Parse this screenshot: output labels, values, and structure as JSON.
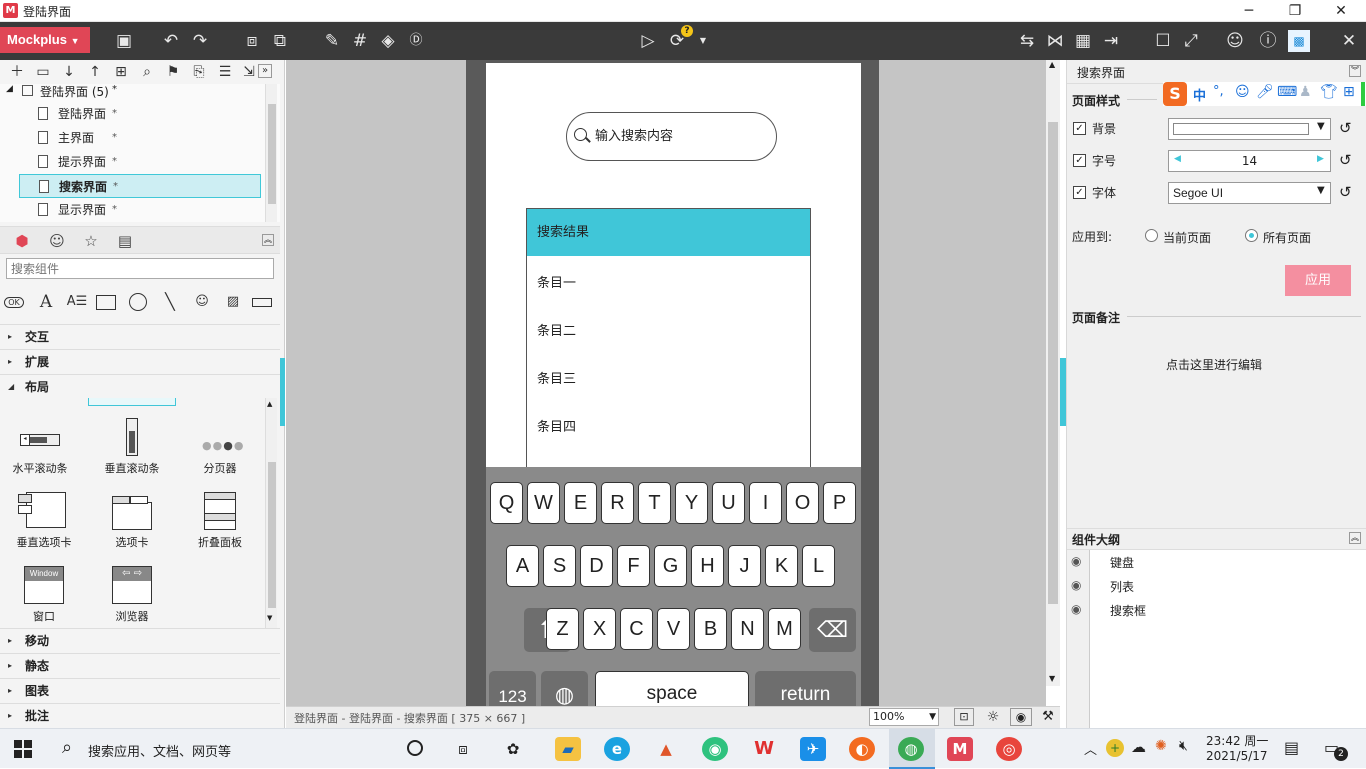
{
  "window": {
    "title": "登陆界面",
    "logo_letter": "M"
  },
  "toolbar": {
    "app_button": "Mockplus",
    "help_badge": "?"
  },
  "left_panel": {
    "tree_root": "登陆界面 (5)",
    "tree_items": [
      {
        "label": "登陆界面",
        "selected": false
      },
      {
        "label": "主界面",
        "selected": false
      },
      {
        "label": "提示界面",
        "selected": false
      },
      {
        "label": "搜索界面",
        "selected": true
      },
      {
        "label": "显示界面",
        "selected": false
      }
    ],
    "modified_mark": "*",
    "component_search_placeholder": "搜索组件",
    "categories_top": [
      "交互",
      "扩展"
    ],
    "open_category": "布局",
    "widgets": [
      {
        "label": "水平滚动条",
        "icon": "horizontal-scrollbar-icon"
      },
      {
        "label": "垂直滚动条",
        "icon": "vertical-scrollbar-icon"
      },
      {
        "label": "分页器",
        "icon": "pager-icon"
      },
      {
        "label": "垂直选项卡",
        "icon": "vertical-tabs-icon"
      },
      {
        "label": "选项卡",
        "icon": "tabs-icon"
      },
      {
        "label": "折叠面板",
        "icon": "accordion-icon"
      },
      {
        "label": "窗口",
        "icon": "window-icon",
        "caption": "Window"
      },
      {
        "label": "浏览器",
        "icon": "browser-icon"
      }
    ],
    "categories_bottom": [
      "移动",
      "静态",
      "图表",
      "批注"
    ]
  },
  "screen": {
    "search_placeholder": "输入搜索内容",
    "list_header": "搜索结果",
    "list_items": [
      "条目一",
      "条目二",
      "条目三",
      "条目四"
    ],
    "keyboard": {
      "row1": [
        "Q",
        "W",
        "E",
        "R",
        "T",
        "Y",
        "U",
        "I",
        "O",
        "P"
      ],
      "row2": [
        "A",
        "S",
        "D",
        "F",
        "G",
        "H",
        "J",
        "K",
        "L"
      ],
      "row3": [
        "Z",
        "X",
        "C",
        "V",
        "B",
        "N",
        "M"
      ],
      "num_key": "123",
      "space_key": "space",
      "return_key": "return"
    }
  },
  "statusbar": {
    "path": "登陆界面 - 登陆界面 - 搜索界面 [ 375 × 667 ]",
    "zoom": "100%"
  },
  "right_panel": {
    "header": "搜索界面",
    "section_page_style": "页面样式",
    "bg_label": "背景",
    "fontsize_label": "字号",
    "fontsize_value": "14",
    "font_label": "字体",
    "font_value": "Segoe UI",
    "apply_to_label": "应用到:",
    "radio_current": "当前页面",
    "radio_all": "所有页面",
    "apply_button": "应用",
    "section_notes": "页面备注",
    "notes_hint": "点击这里进行编辑",
    "outline_title": "组件大纲",
    "outline_items": [
      "键盘",
      "列表",
      "搜索框"
    ],
    "ime_label": "中"
  },
  "taskbar": {
    "search_text": "搜索应用、文档、网页等",
    "time": "23:42 周一",
    "date": "2021/5/17",
    "notification_count": "2"
  },
  "colors": {
    "accent": "#40c6d8",
    "brand": "#e04656",
    "apply_button": "#f48fa0"
  }
}
